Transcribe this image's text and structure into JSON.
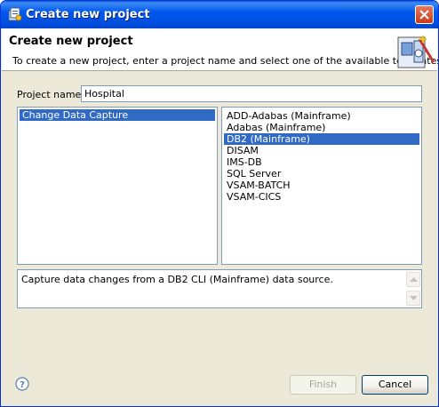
{
  "window": {
    "title": "Create new project"
  },
  "header": {
    "title": "Create new project",
    "description": "To create a new project, enter a project name and select one of the available templates."
  },
  "form": {
    "project_name_label": "Project name:",
    "project_name_value": "Hospital"
  },
  "categories": {
    "items": [
      {
        "label": "Change Data Capture",
        "selected": true
      }
    ]
  },
  "templates": {
    "items": [
      {
        "label": "ADD-Adabas (Mainframe)",
        "selected": false
      },
      {
        "label": "Adabas (Mainframe)",
        "selected": false
      },
      {
        "label": "DB2 (Mainframe)",
        "selected": true
      },
      {
        "label": "DISAM",
        "selected": false
      },
      {
        "label": "IMS-DB",
        "selected": false
      },
      {
        "label": "SQL Server",
        "selected": false
      },
      {
        "label": "VSAM-BATCH",
        "selected": false
      },
      {
        "label": "VSAM-CICS",
        "selected": false
      }
    ]
  },
  "template_description": "Capture data changes from a DB2 CLI (Mainframe) data source.",
  "buttons": {
    "finish_label": "Finish",
    "finish_enabled": false,
    "cancel_label": "Cancel"
  },
  "icons": {
    "app": "app-icon",
    "close": "close-icon",
    "wizard": "new-project-wizard-icon",
    "help": "help-icon",
    "scroll_up": "scroll-up-arrow-icon",
    "scroll_down": "scroll-down-arrow-icon"
  },
  "colors": {
    "titlebar": "#0058ee",
    "selection": "#316ac5",
    "dialog_bg": "#ece9d8",
    "close_button": "#c93b1a"
  }
}
